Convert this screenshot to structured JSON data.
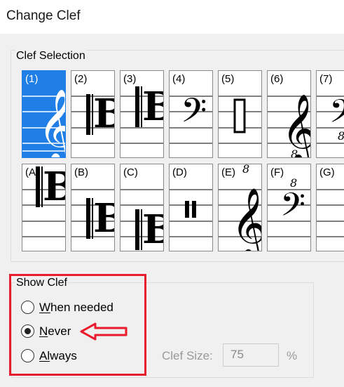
{
  "window": {
    "title": "Change Clef"
  },
  "clef_selection": {
    "label": "Clef Selection",
    "selected": "(1)",
    "row1": [
      {
        "label": "(1)",
        "icon": "treble-clef-icon"
      },
      {
        "label": "(2)",
        "icon": "alto-clef-icon"
      },
      {
        "label": "(3)",
        "icon": "tenor-clef-icon"
      },
      {
        "label": "(4)",
        "icon": "bass-clef-icon"
      },
      {
        "label": "(5)",
        "icon": "tab-clef-icon"
      },
      {
        "label": "(6)",
        "icon": "treble-8vb-clef-icon"
      },
      {
        "label": "(7)",
        "icon": "bass-8vb-clef-icon"
      }
    ],
    "row2": [
      {
        "label": "(A)",
        "icon": "c-clef-high-icon"
      },
      {
        "label": "(B)",
        "icon": "c-clef-low-icon"
      },
      {
        "label": "(C)",
        "icon": "c-clef-lowest-icon"
      },
      {
        "label": "(D)",
        "icon": "percussion-clef-icon"
      },
      {
        "label": "(E)",
        "icon": "treble-8va-clef-icon"
      },
      {
        "label": "(F)",
        "icon": "bass-8va-clef-icon"
      },
      {
        "label": "(G)",
        "icon": "empty-clef-icon"
      }
    ]
  },
  "show_clef": {
    "label": "Show Clef",
    "options": [
      {
        "label_u": "W",
        "label_rest": "hen needed",
        "checked": false
      },
      {
        "label_u": "N",
        "label_rest": "ever",
        "checked": true
      },
      {
        "label_u": "Al",
        "label_rest": "ways",
        "checked": false
      }
    ],
    "clef_size_label": "Clef Size:",
    "clef_size_value": "75",
    "percent": "%"
  }
}
